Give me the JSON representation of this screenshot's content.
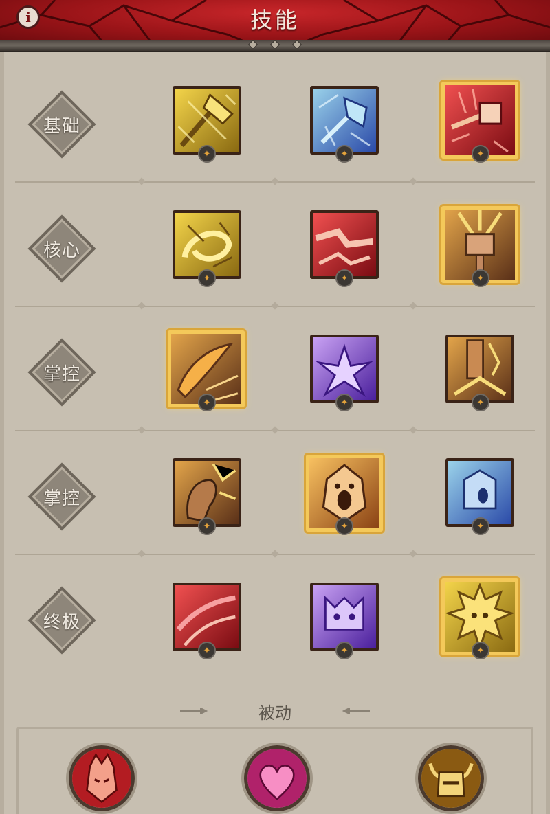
{
  "header": {
    "title": "技能",
    "info_label": "i"
  },
  "rows": [
    {
      "label": "基础"
    },
    {
      "label": "核心"
    },
    {
      "label": "掌控"
    },
    {
      "label": "掌控"
    },
    {
      "label": "终极"
    }
  ],
  "skills": [
    [
      {
        "icon": "axe-strike-icon",
        "color": "yellow",
        "selected": false
      },
      {
        "icon": "frost-axe-icon",
        "color": "blue",
        "selected": false
      },
      {
        "icon": "flaming-hammer-icon",
        "color": "red",
        "selected": true
      }
    ],
    [
      {
        "icon": "whirlwind-icon",
        "color": "yellow",
        "selected": false
      },
      {
        "icon": "rend-icon",
        "color": "red",
        "selected": false
      },
      {
        "icon": "hammer-of-ancients-icon",
        "color": "brown",
        "selected": true
      }
    ],
    [
      {
        "icon": "charge-icon",
        "color": "brown",
        "selected": true
      },
      {
        "icon": "shatter-icon",
        "color": "purple",
        "selected": false
      },
      {
        "icon": "ground-stomp-icon",
        "color": "brown",
        "selected": false
      }
    ],
    [
      {
        "icon": "iron-fist-icon",
        "color": "brown",
        "selected": false
      },
      {
        "icon": "war-cry-icon",
        "color": "orange",
        "selected": true
      },
      {
        "icon": "challenging-shout-icon",
        "color": "blue",
        "selected": false
      }
    ],
    [
      {
        "icon": "blood-slash-icon",
        "color": "red",
        "selected": false
      },
      {
        "icon": "call-of-ancients-icon",
        "color": "purple",
        "selected": false
      },
      {
        "icon": "wrath-of-berserker-icon",
        "color": "yellow",
        "selected": true
      }
    ]
  ],
  "passive": {
    "title": "被动",
    "items": [
      {
        "icon": "rage-face-icon"
      },
      {
        "icon": "heart-icon"
      },
      {
        "icon": "horned-helmet-icon"
      }
    ]
  },
  "colors": {
    "header_red": "#9a1418",
    "panel_bg": "#c7bfb1",
    "selected_border": "#f4c95a",
    "label_diamond": "#8e867a"
  }
}
